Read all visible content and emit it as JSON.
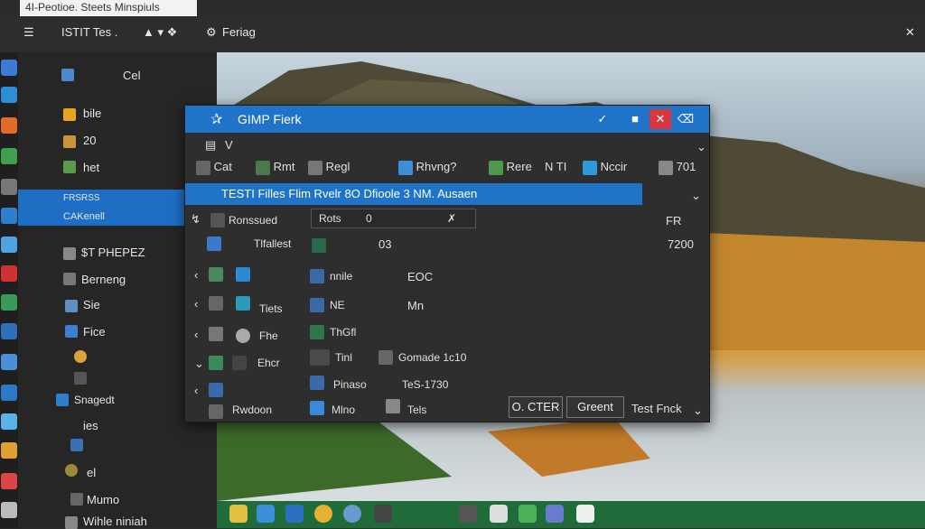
{
  "window": {
    "title": "4I-Peotioe. Steets Minspiuls"
  },
  "topbar": {
    "menu_label": "ISTIT Tes .",
    "settings_label": "Feriag"
  },
  "sidebar": {
    "items": [
      {
        "label": "Cel",
        "icon": "image-icon"
      },
      {
        "label": "bile",
        "icon": "folder-icon"
      },
      {
        "label": "20",
        "icon": "folder-icon"
      },
      {
        "label": "het",
        "icon": "photo-icon"
      },
      {
        "label": "FRSRSS",
        "icon": ""
      },
      {
        "label": "CAKenell",
        "icon": ""
      },
      {
        "label": "$T PHEPEZ",
        "icon": "document-icon"
      },
      {
        "label": "Berneng",
        "icon": "document-icon"
      },
      {
        "label": "Sie",
        "icon": "grid-icon"
      },
      {
        "label": "Fice",
        "icon": "monitor-icon"
      },
      {
        "label": "Snagedt",
        "icon": "monitor-icon"
      },
      {
        "label": "ies",
        "icon": "folder-icon"
      },
      {
        "label": "el",
        "icon": "user-icon"
      },
      {
        "label": "Mumo",
        "icon": "app-icon"
      },
      {
        "label": "Wihle niniah",
        "icon": "app-icon"
      }
    ]
  },
  "dialog": {
    "title": "GIMP Fierk",
    "path_label": "V",
    "toolbar": [
      "Cat",
      "Rmt",
      "Regl",
      "Rhvng?",
      "Rere",
      "N TI",
      "Nccir",
      "701"
    ],
    "selected_row": "TESTI Filles Flim Rvelr 8O Dfioole 3 NM. Ausaen",
    "filter_label": "Rots",
    "filter_value": "0",
    "rows": [
      {
        "label": "Ronssued",
        "right": "FR"
      },
      {
        "label": "Tlfallest",
        "value": "03",
        "right": "7200"
      },
      {
        "label": "",
        "name": "nnile",
        "value": "EOC"
      },
      {
        "label": "Tiets",
        "name": "NE",
        "value": "Mn"
      },
      {
        "label": "Fhe",
        "name": "ThGfl"
      },
      {
        "label": "Ehcr",
        "name": "Tinl",
        "value": "Gomade 1c10"
      },
      {
        "label": "",
        "name": "Pinaso",
        "value": "TeS-1730"
      },
      {
        "label": "Rwdoon",
        "name": "Mlno",
        "value": "Tels"
      }
    ],
    "buttons": {
      "ok": "O. CTER",
      "green": "Greent",
      "test": "Test Fnck"
    }
  },
  "taskbar": {
    "icons": [
      "app-icon",
      "puzzle-icon",
      "folder-icon",
      "browser-icon",
      "globe-icon",
      "terminal-icon",
      "document-icon",
      "mail-icon",
      "leaf-icon",
      "files-icon",
      "phone-icon"
    ]
  }
}
